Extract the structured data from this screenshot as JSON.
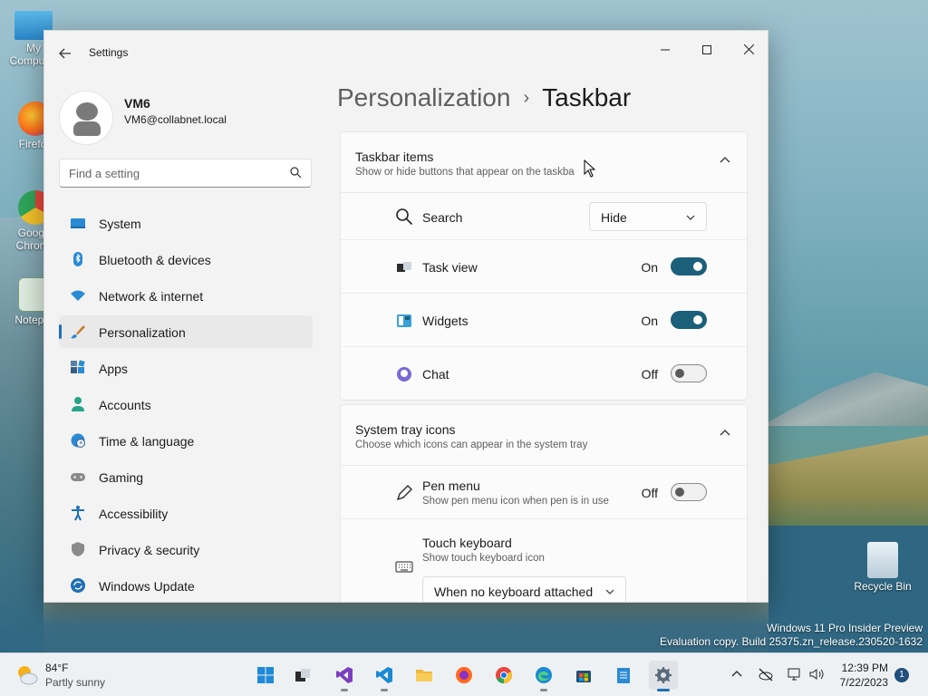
{
  "desktop": {
    "icons": [
      {
        "label": "My Computer"
      },
      {
        "label": "Firefox"
      },
      {
        "label": "Google Chrome"
      },
      {
        "label": "Notepad"
      },
      {
        "label": "Recycle Bin"
      }
    ],
    "watermark": {
      "line1": "Windows 11 Pro Insider Preview",
      "line2": "Evaluation copy. Build 25375.zn_release.230520-1632"
    }
  },
  "window": {
    "title": "Settings",
    "user": {
      "name": "VM6",
      "email": "VM6@collabnet.local"
    },
    "search": {
      "placeholder": "Find a setting"
    },
    "nav": [
      {
        "label": "System",
        "icon": "monitor-icon"
      },
      {
        "label": "Bluetooth & devices",
        "icon": "bluetooth-icon"
      },
      {
        "label": "Network & internet",
        "icon": "wifi-icon"
      },
      {
        "label": "Personalization",
        "icon": "brush-icon",
        "active": true
      },
      {
        "label": "Apps",
        "icon": "apps-icon"
      },
      {
        "label": "Accounts",
        "icon": "person-icon"
      },
      {
        "label": "Time & language",
        "icon": "globe-clock-icon"
      },
      {
        "label": "Gaming",
        "icon": "gamepad-icon"
      },
      {
        "label": "Accessibility",
        "icon": "accessibility-icon"
      },
      {
        "label": "Privacy & security",
        "icon": "shield-icon"
      },
      {
        "label": "Windows Update",
        "icon": "update-icon"
      }
    ],
    "breadcrumb": {
      "parent": "Personalization",
      "separator": "›",
      "current": "Taskbar"
    },
    "taskbar_items": {
      "title": "Taskbar items",
      "subtitle": "Show or hide buttons that appear on the taskba",
      "search": {
        "label": "Search",
        "value": "Hide"
      },
      "task_view": {
        "label": "Task view",
        "state": "On"
      },
      "widgets": {
        "label": "Widgets",
        "state": "On"
      },
      "chat": {
        "label": "Chat",
        "state": "Off"
      }
    },
    "system_tray": {
      "title": "System tray icons",
      "subtitle": "Choose which icons can appear in the system tray",
      "pen_menu": {
        "label": "Pen menu",
        "sub": "Show pen menu icon when pen is in use",
        "state": "Off"
      },
      "touch_keyboard": {
        "label": "Touch keyboard",
        "sub": "Show touch keyboard icon",
        "value": "When no keyboard attached"
      }
    }
  },
  "taskbar": {
    "weather": {
      "temp": "84°F",
      "desc": "Partly sunny"
    },
    "clock": {
      "time": "12:39 PM",
      "date": "7/22/2023"
    },
    "notification_count": "1"
  }
}
